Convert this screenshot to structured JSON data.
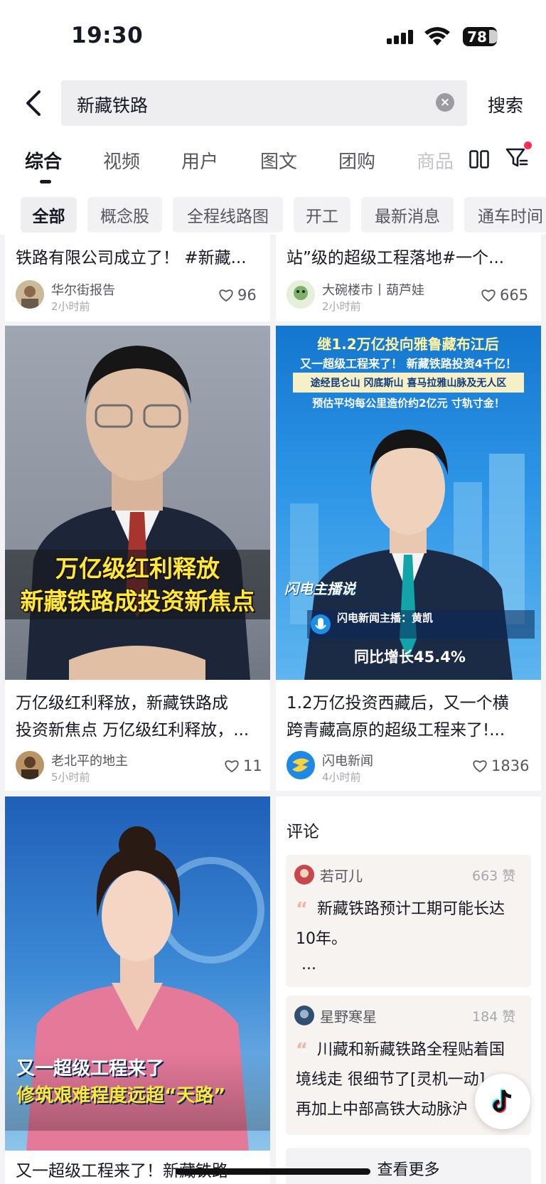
{
  "status_bar": {
    "time": "19:30",
    "battery": "78"
  },
  "search": {
    "query": "新藏铁路",
    "clear_icon": "×",
    "submit_label": "搜索"
  },
  "tabs": [
    {
      "label": "综合",
      "active": true
    },
    {
      "label": "视频"
    },
    {
      "label": "用户"
    },
    {
      "label": "图文"
    },
    {
      "label": "团购"
    },
    {
      "label": "商品"
    }
  ],
  "chips": [
    {
      "label": "全部",
      "active": true
    },
    {
      "label": "概念股"
    },
    {
      "label": "全程线路图"
    },
    {
      "label": "开工"
    },
    {
      "label": "最新消息"
    },
    {
      "label": "通车时间"
    }
  ],
  "top_cards": [
    {
      "title": "铁路有限公司成立了！ #新藏...",
      "author": "华尔街报告",
      "time": "2小时前",
      "likes": "96"
    },
    {
      "title": "站”级的超级工程落地#一个...",
      "author": "大碗楼市丨葫芦娃",
      "time": "2小时前",
      "likes": "665"
    }
  ],
  "cards": [
    {
      "thumb_caption_1": "万亿级红利释放",
      "thumb_caption_2": "新藏铁路成投资新焦点",
      "title_line1": "万亿级红利释放，新藏铁路成",
      "title_line2": "投资新焦点 万亿级红利释放，...",
      "author": "老北平的地主",
      "time": "5小时前",
      "likes": "11"
    },
    {
      "banner_line1": "继1.2万亿投向雅鲁藏布江后",
      "banner_line2": "又一超级工程来了！ 新藏铁路投资4千亿！",
      "banner_line3": "途经昆仑山 冈底斯山 喜马拉雅山脉及无人区",
      "banner_line4": "预估平均每公里造价约2亿元 寸轨寸金！",
      "logo_text": "闪电主播说",
      "anchor_label": "闪电新闻主播：黄凯",
      "growth_text": "同比增长45.4%",
      "title_line1": "1.2万亿投资西藏后，又一个横",
      "title_line2": "跨青藏高原的超级工程来了!...",
      "author": "闪电新闻",
      "time": "4小时前",
      "likes": "1836"
    },
    {
      "thumb_caption_1": "又一超级工程来了",
      "thumb_caption_2": "修筑艰难程度远超“天路”",
      "title_line1": "又一超级工程来了！新藏铁路"
    }
  ],
  "comments_card": {
    "title": "评论",
    "items": [
      {
        "user": "若可儿",
        "likes": "663 赞",
        "text_line1": "新藏铁路预计工期可能长达",
        "text_line2": "10年。",
        "ellipsis": "..."
      },
      {
        "user": "星野寒星",
        "likes": "184 赞",
        "text_line1": "川藏和新藏铁路全程贴着国",
        "text_line2": "境线走 很细节了[灵机一动]",
        "text_line3": "再加上中部高铁大动脉沪"
      }
    ],
    "see_more": "查看更多"
  },
  "colors": {
    "accent": "#fe2c55",
    "like_heart": "#55565f",
    "caption_yellow": "#ffe83a",
    "news_blue": "#1d7ed6"
  }
}
